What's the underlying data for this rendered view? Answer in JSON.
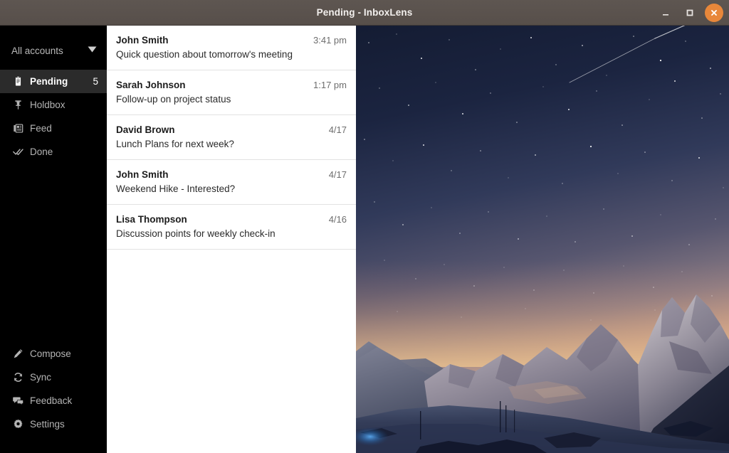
{
  "window": {
    "title": "Pending - InboxLens",
    "controls": [
      {
        "name": "minimize",
        "label": "Minimize"
      },
      {
        "name": "maximize",
        "label": "Maximize"
      },
      {
        "name": "close",
        "label": "Close"
      }
    ],
    "titlebar_color": "#574f4a",
    "close_button_color": "#e8873a"
  },
  "sidebar": {
    "account": {
      "label": "All accounts",
      "caret": "chevron-down-icon"
    },
    "folders": [
      {
        "label": "Pending",
        "icon": "clipboard-icon",
        "count": "5",
        "selected": true
      },
      {
        "label": "Holdbox",
        "icon": "pin-icon",
        "count": "",
        "selected": false
      },
      {
        "label": "Feed",
        "icon": "feed-icon",
        "count": "",
        "selected": false
      },
      {
        "label": "Done",
        "icon": "double-check-icon",
        "count": "",
        "selected": false
      }
    ],
    "actions": [
      {
        "label": "Compose",
        "icon": "pencil-icon"
      },
      {
        "label": "Sync",
        "icon": "sync-icon"
      },
      {
        "label": "Feedback",
        "icon": "chat-bubbles-icon"
      },
      {
        "label": "Settings",
        "icon": "gear-icon"
      }
    ],
    "background_color": "#000000",
    "selected_color": "#2b2b2b"
  },
  "message_list": {
    "messages": [
      {
        "sender": "John Smith",
        "date": "3:41 pm",
        "subject": "Quick question about tomorrow's meeting"
      },
      {
        "sender": "Sarah Johnson",
        "date": "1:17 pm",
        "subject": "Follow-up on project status"
      },
      {
        "sender": "David Brown",
        "date": "4/17",
        "subject": "Lunch Plans for next week?"
      },
      {
        "sender": "John Smith",
        "date": "4/17",
        "subject": "Weekend Hike - Interested?"
      },
      {
        "sender": "Lisa Thompson",
        "date": "4/16",
        "subject": "Discussion points for weekly check-in"
      }
    ]
  },
  "reading_pane": {
    "image": "starry-night-snowy-mountains",
    "sky_top_color": "#151d36",
    "sky_mid_color": "#6b6478",
    "horizon_glow_color": "#d8ab82",
    "snow_color": "#2b3550"
  }
}
